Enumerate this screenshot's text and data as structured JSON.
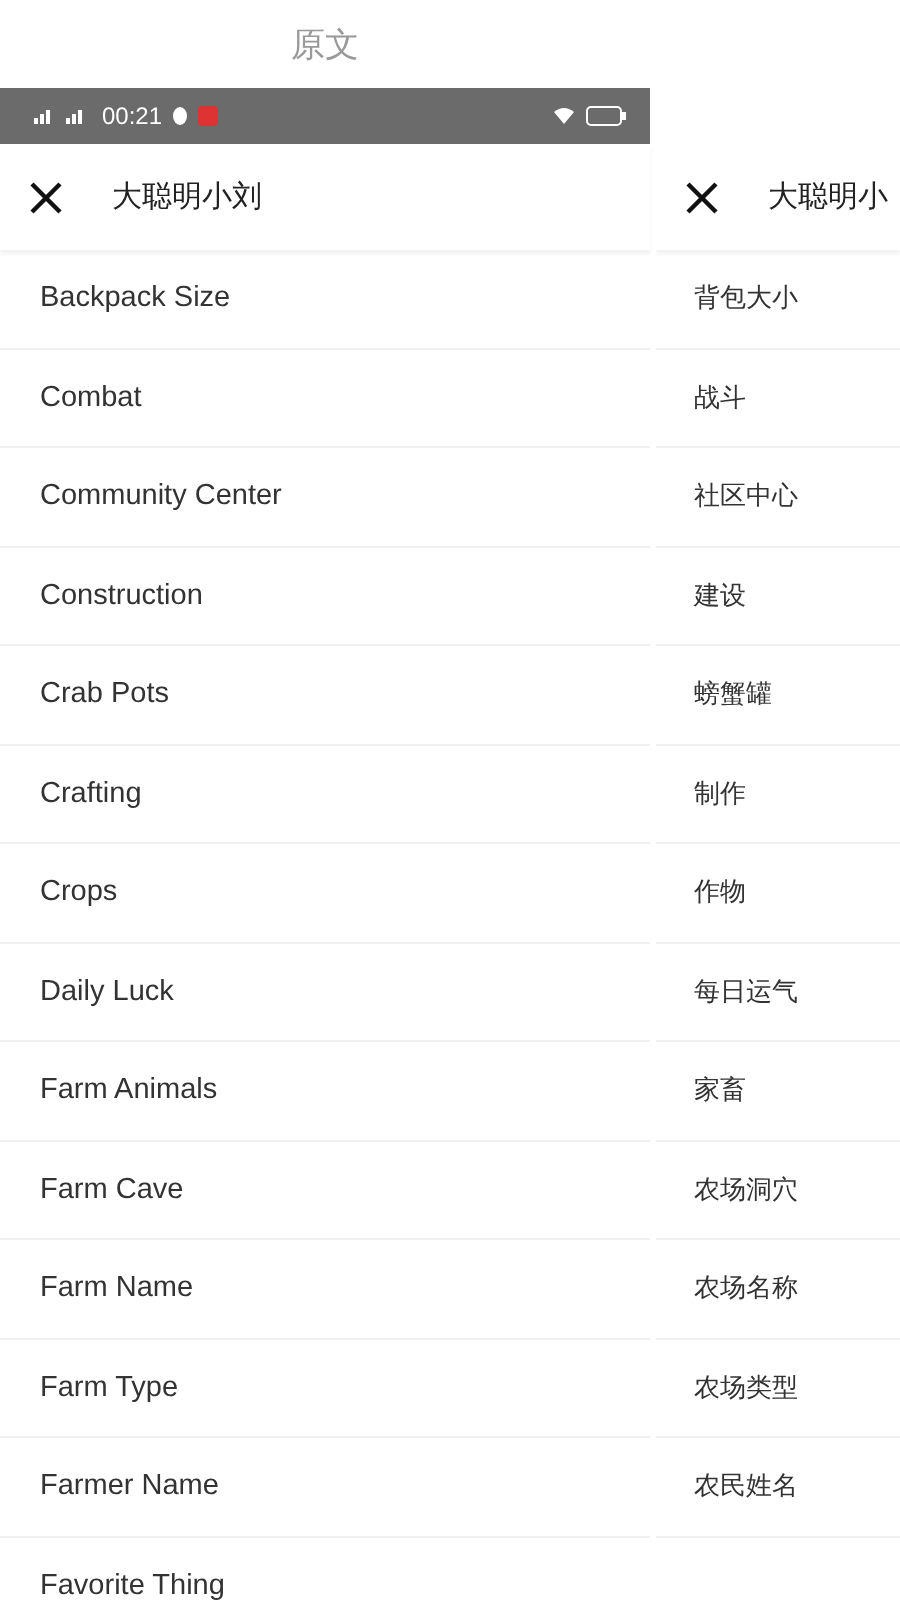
{
  "caption": "原文",
  "status_bar": {
    "time": "00:21"
  },
  "panels": [
    {
      "title": "大聪明小刘",
      "items": [
        "Backpack Size",
        "Combat",
        "Community Center",
        "Construction",
        "Crab Pots",
        "Crafting",
        "Crops",
        "Daily Luck",
        "Farm Animals",
        "Farm Cave",
        "Farm Name",
        "Farm Type",
        "Farmer Name",
        "Favorite Thing"
      ]
    },
    {
      "title": "大聪明小",
      "items": [
        "背包大小",
        "战斗",
        "社区中心",
        "建设",
        "螃蟹罐",
        "制作",
        "作物",
        "每日运气",
        "家畜",
        "农场洞穴",
        "农场名称",
        "农场类型",
        "农民姓名"
      ]
    }
  ]
}
